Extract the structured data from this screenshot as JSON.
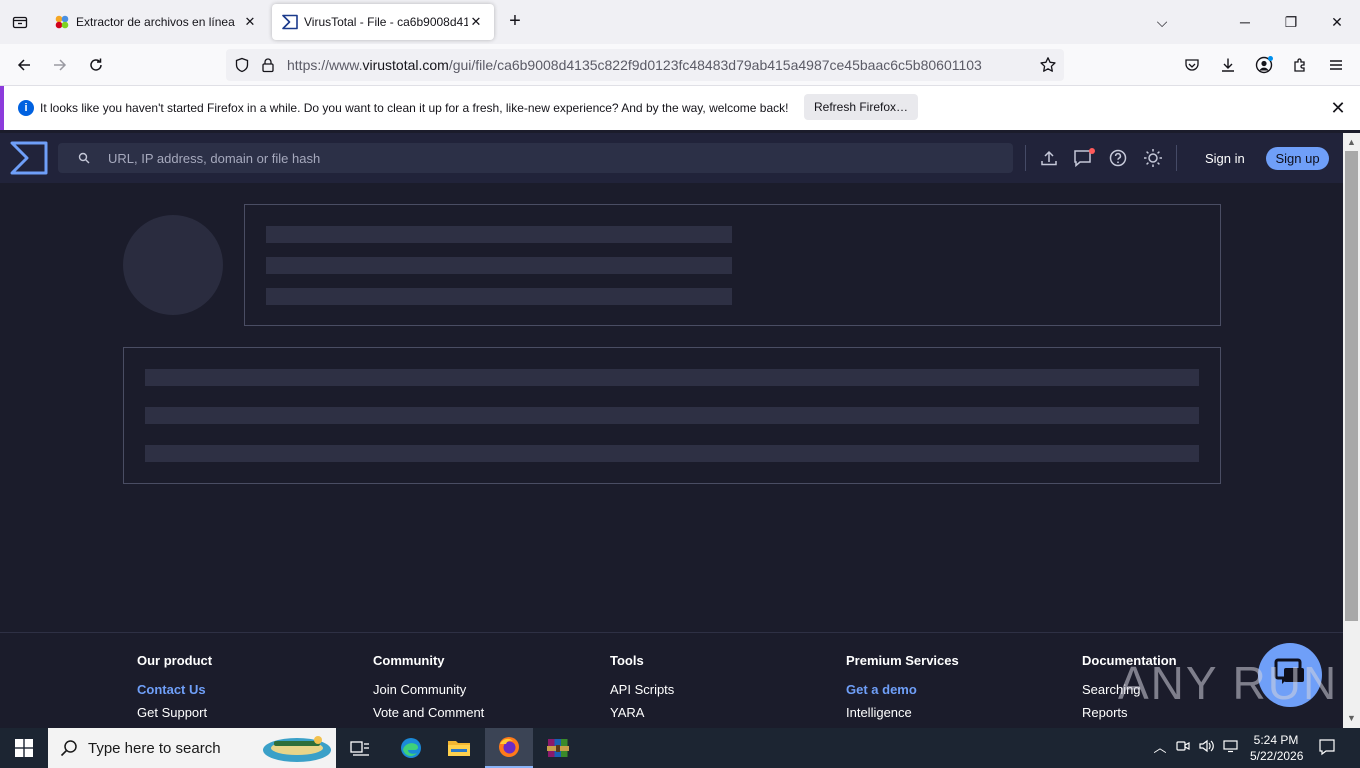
{
  "browser": {
    "tabs": [
      {
        "title": "Extractor de archivos en línea",
        "active": false
      },
      {
        "title": "VirusTotal - File - ca6b9008d41",
        "active": true
      }
    ],
    "url_prefix": "https://www.",
    "url_domain": "virustotal.com",
    "url_path": "/gui/file/ca6b9008d4135c822f9d0123fc48483d79ab415a4987ce45baac6c5b80601103",
    "notification": {
      "message": "It looks like you haven't started Firefox in a while. Do you want to clean it up for a fresh, like-new experience? And by the way, welcome back!",
      "button": "Refresh Firefox…"
    }
  },
  "virustotal": {
    "search_placeholder": "URL, IP address, domain or file hash",
    "signin": "Sign in",
    "signup": "Sign up",
    "accent": "#6f9ff8"
  },
  "footer": {
    "columns": [
      {
        "heading": "Our product",
        "links": [
          "Contact Us",
          "Get Support"
        ],
        "highlight": [
          0
        ]
      },
      {
        "heading": "Community",
        "links": [
          "Join Community",
          "Vote and Comment"
        ],
        "highlight": []
      },
      {
        "heading": "Tools",
        "links": [
          "API Scripts",
          "YARA"
        ],
        "highlight": []
      },
      {
        "heading": "Premium Services",
        "links": [
          "Get a demo",
          "Intelligence"
        ],
        "highlight": [
          0
        ]
      },
      {
        "heading": "Documentation",
        "links": [
          "Searching",
          "Reports"
        ],
        "highlight": []
      }
    ]
  },
  "watermark": "ANY RUN",
  "taskbar": {
    "search_placeholder": "Type here to search",
    "time": "5:24 PM",
    "date": "5/22/2026"
  }
}
